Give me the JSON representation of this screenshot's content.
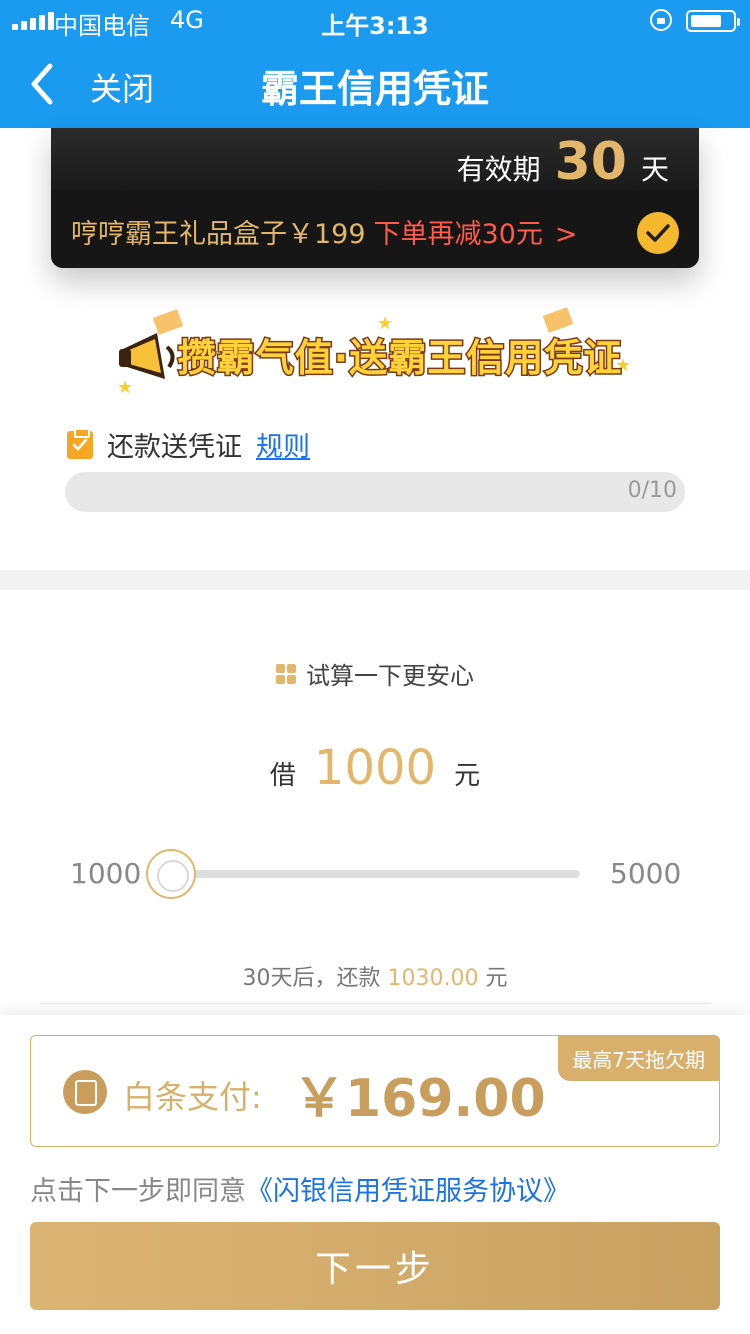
{
  "status_bar": {
    "carrier": "中国电信",
    "network": "4G",
    "time": "上午3:13"
  },
  "nav": {
    "close_label": "关闭",
    "title": "霸王信用凭证"
  },
  "card": {
    "validity_label": "有效期",
    "validity_days": "30",
    "validity_unit": "天",
    "promo_item": "哼哼霸王礼品盒子￥199",
    "promo_offer": "下单再减30元",
    "promo_arrow": ">",
    "checked": true
  },
  "banner": {
    "text": "攒霸气值·送霸王信用凭证"
  },
  "rewards": {
    "label": "还款送凭证",
    "rule_link": "规则",
    "progress_text": "0/10",
    "progress_value": 0
  },
  "calculator": {
    "header": "试算一下更安心",
    "borrow_prefix": "借",
    "amount": "1000",
    "amount_unit": "元",
    "slider_min": "1000",
    "slider_max": "5000",
    "slider_value": 1000,
    "repay_prefix": "30天后，还款",
    "repay_amount": "1030.00",
    "repay_unit": "元"
  },
  "payment": {
    "tag": "最高7天拖欠期",
    "method_label": "白条支付:",
    "amount": "￥169.00"
  },
  "agreement": {
    "prefix": "点击下一步即同意",
    "link": "《闪银信用凭证服务协议》"
  },
  "next_button": "下一步",
  "colors": {
    "nav_blue": "#1a9bf0",
    "gold": "#e3b76b",
    "promo_red": "#ff5a4a",
    "link_blue": "#1a73e8"
  }
}
